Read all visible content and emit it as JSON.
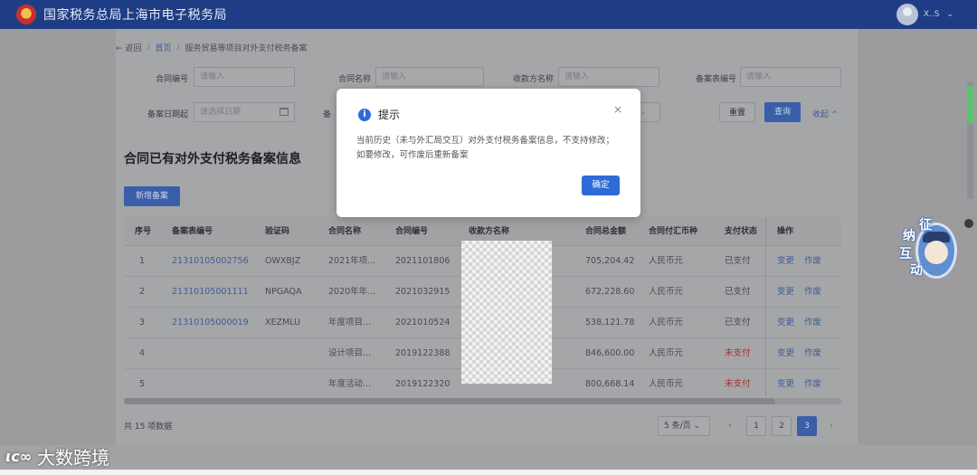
{
  "header": {
    "brand": "国家税务总局上海市电子税务局",
    "user_name": "X..S",
    "user_caret": "⌄"
  },
  "breadcrumb": {
    "back": "← 返回",
    "home": "首页",
    "sep": "/",
    "current": "服务贸易等项目对外支付税务备案"
  },
  "filters": {
    "contract_no_label": "合同编号",
    "contract_no_placeholder": "请输入",
    "contract_name_label": "合同名称",
    "contract_name_placeholder": "请输入",
    "payee_label": "收款方名称",
    "payee_placeholder": "请输入",
    "record_no_label": "备案表编号",
    "record_no_placeholder": "请输入",
    "date_start_label": "备案日期起",
    "date_start_placeholder": "请选择日期",
    "partial_label": "备",
    "reset_label": "重置",
    "query_label": "查询",
    "collapse_label": "收起 ^"
  },
  "section": {
    "title": "合同已有对外支付税务备案信息",
    "add_label": "新增备案"
  },
  "table": {
    "columns": [
      "序号",
      "备案表编号",
      "验证码",
      "合同名称",
      "合同编号",
      "收款方名称",
      "合同总金额",
      "合同付汇币种",
      "支付状态",
      "操作"
    ],
    "rows": [
      {
        "seq": "1",
        "record_no": "21310105002756",
        "code": "OWXBJZ",
        "name": "2021年项...",
        "contract_no": "2021101806",
        "amount": "705,204.42",
        "currency": "人民币元",
        "status": "已支付",
        "op1": "变更",
        "op2": "作废"
      },
      {
        "seq": "2",
        "record_no": "21310105001111",
        "code": "NPGAQA",
        "name": "2020年年...",
        "contract_no": "2021032915",
        "amount": "672,228.60",
        "currency": "人民币元",
        "status": "已支付",
        "op1": "变更",
        "op2": "作废"
      },
      {
        "seq": "3",
        "record_no": "21310105000019",
        "code": "XEZMLU",
        "name": "年度项目...",
        "contract_no": "2021010524",
        "amount": "538,121.78",
        "currency": "人民币元",
        "status": "已支付",
        "op1": "变更",
        "op2": "作废"
      },
      {
        "seq": "4",
        "record_no": "",
        "code": "",
        "name": "设计项目...",
        "contract_no": "2019122388",
        "amount": "846,600.00",
        "currency": "人民币元",
        "status": "未支付",
        "op1": "变更",
        "op2": "作废"
      },
      {
        "seq": "5",
        "record_no": "",
        "code": "",
        "name": "年度活动...",
        "contract_no": "2019122320",
        "amount": "800,668.14",
        "currency": "人民币元",
        "status": "未支付",
        "op1": "变更",
        "op2": "作废"
      }
    ]
  },
  "pagination": {
    "total": "共 15 项数据",
    "page_size": "5 条/页 ⌄",
    "prev": "‹",
    "pages": [
      "1",
      "2",
      "3"
    ],
    "active_page": "3",
    "next": "›"
  },
  "mascot": {
    "c1": "征",
    "c2": "纳",
    "c3": "互",
    "c4": "动"
  },
  "watermark": {
    "logo": "ιᴄ∞",
    "text": "大数跨境"
  },
  "modal": {
    "icon": "i",
    "title": "提示",
    "close": "×",
    "message": "当前历史（未与外汇局交互）对外支付税务备案信息，不支持修改；如要修改，可作废后重新备案",
    "ok_label": "确定"
  },
  "colors": {
    "header_bg": "#1f3d84",
    "primary": "#2e6bd8",
    "unpaid": "#a8322d"
  }
}
